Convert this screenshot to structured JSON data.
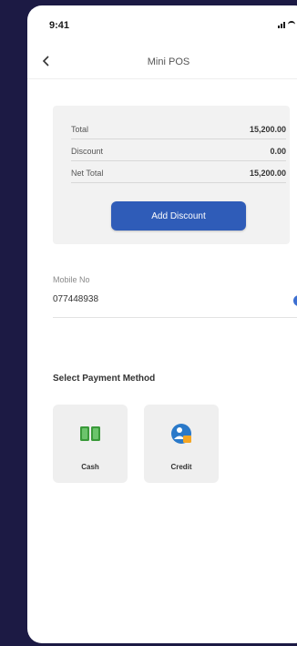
{
  "status_bar": {
    "time": "9:41",
    "icons": [
      "signal-icon",
      "wifi-icon",
      "battery-icon"
    ]
  },
  "nav": {
    "title": "Mini POS",
    "back_icon": "chevron-left-icon"
  },
  "summary": {
    "rows": [
      {
        "label": "Total",
        "value": "15,200.00"
      },
      {
        "label": "Discount",
        "value": "0.00"
      },
      {
        "label": "Net Total",
        "value": "15,200.00"
      }
    ],
    "add_discount_label": "Add Discount"
  },
  "mobile": {
    "label": "Mobile No",
    "value": "077448938",
    "info_icon": "info-icon"
  },
  "payment": {
    "heading": "Select Payment Method",
    "methods": [
      {
        "label": "Cash",
        "icon": "cash-icon"
      },
      {
        "label": "Credit",
        "icon": "credit-icon"
      }
    ]
  },
  "colors": {
    "background": "#1c1a44",
    "accent": "#2f5cb8",
    "card": "#f2f2f2",
    "cash_green": "#3a9a3a",
    "credit_blue": "#2a79c9",
    "credit_orange": "#f5a623"
  }
}
